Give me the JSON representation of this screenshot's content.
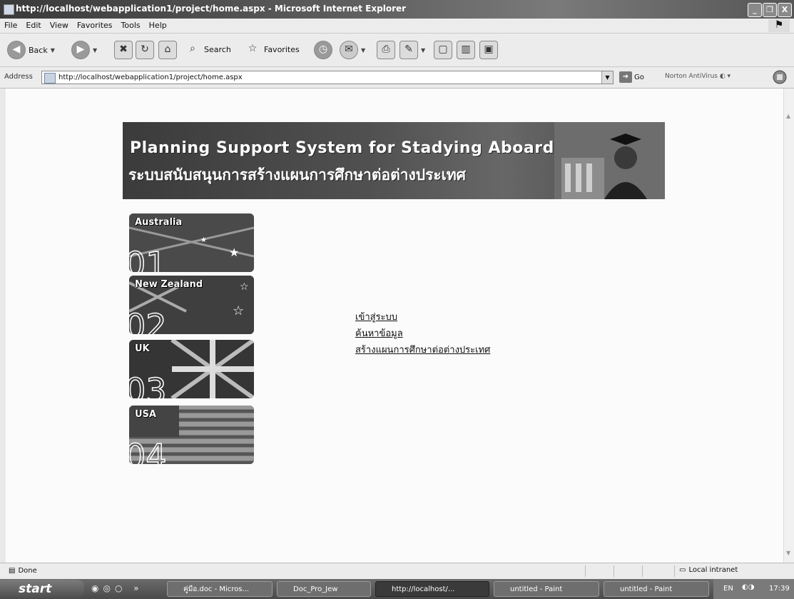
{
  "window": {
    "title": "http://localhost/webapplication1/project/home.aspx - Microsoft Internet Explorer",
    "controls": [
      "_",
      "❐",
      "X"
    ]
  },
  "menu": [
    "File",
    "Edit",
    "View",
    "Favorites",
    "Tools",
    "Help"
  ],
  "toolbar": {
    "back_label": "Back",
    "search_label": "Search",
    "favorites_label": "Favorites"
  },
  "address": {
    "label": "Address",
    "url": "http://localhost/webapplication1/project/home.aspx",
    "go_label": "Go",
    "norton_label": "Norton AntiVirus"
  },
  "banner": {
    "title_en": "Planning Support System for Stadying Aboard",
    "title_th": "ระบบสนับสนุนการสร้างแผนการศึกษาต่อต่างประเทศ"
  },
  "countries": [
    {
      "name": "Australia",
      "number": "01"
    },
    {
      "name": "New Zealand",
      "number": "02"
    },
    {
      "name": "UK",
      "number": "03"
    },
    {
      "name": "USA",
      "number": "04"
    }
  ],
  "links": {
    "login": "เข้าสู่ระบบ",
    "search": "ค้นหาข้อมูล",
    "create_plan": "สร้างแผนการศึกษาต่อต่างประเทศ"
  },
  "status": {
    "left": "Done",
    "zone": "Local intranet"
  },
  "taskbar": {
    "start_label": "start",
    "tasks": [
      "คู่มือ.doc - Micros...",
      "Doc_Pro_Jew",
      "http://localhost/...",
      "untitled - Paint",
      "untitled - Paint"
    ],
    "lang": "EN",
    "clock": "17:39"
  }
}
